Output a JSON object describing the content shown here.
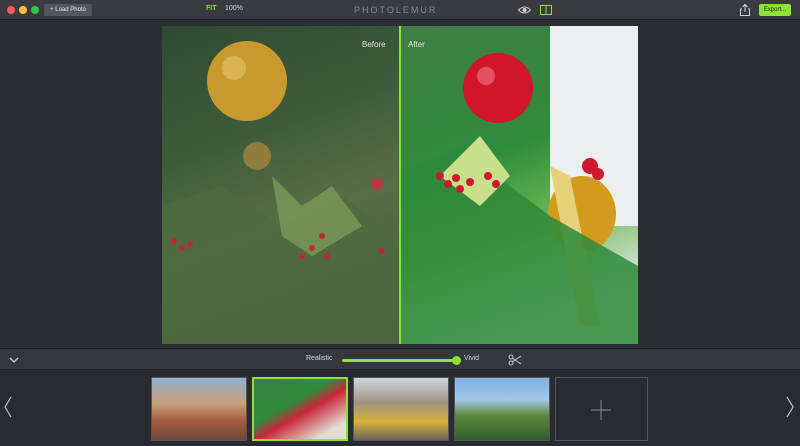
{
  "titlebar": {
    "load_photo": "+ Load Photo",
    "fit": "FIT",
    "zoom": "100%",
    "app_title": "PHOTOLEMUR",
    "export": "Export..."
  },
  "viewer": {
    "before_label": "Before",
    "after_label": "After"
  },
  "controls": {
    "realistic_label": "Realistic",
    "vivid_label": "Vivid",
    "slider_value": 1.0
  },
  "icons": [
    "eye-icon",
    "split-view-icon",
    "share-icon",
    "chevron-down-icon",
    "compare-icon",
    "chevron-left-icon",
    "chevron-right-icon",
    "plus-icon"
  ],
  "colors": {
    "accent": "#8ee03a"
  }
}
